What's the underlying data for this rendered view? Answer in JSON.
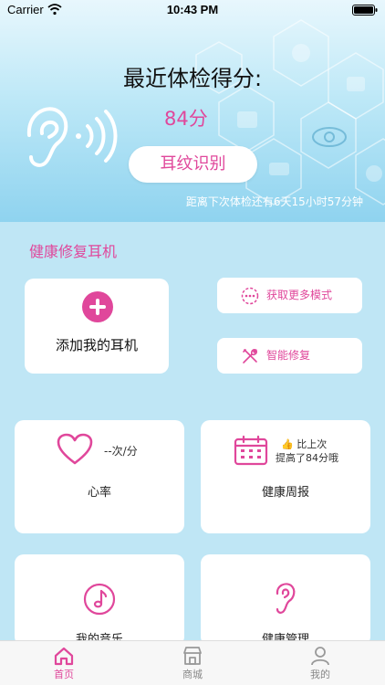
{
  "status_bar": {
    "carrier": "Carrier",
    "time": "10:43 PM"
  },
  "header": {
    "score_title": "最近体检得分:",
    "score_value": "84分",
    "earprint_button": "耳纹识别",
    "countdown": "距离下次体检还有6天15小时57分钟"
  },
  "section": {
    "title": "健康修复耳机"
  },
  "add_card": {
    "label": "添加我的耳机"
  },
  "pills": {
    "more_modes": "获取更多模式",
    "smart_repair": "智能修复"
  },
  "heart_card": {
    "rate": "--次/分",
    "label": "心率"
  },
  "report_card": {
    "compare_line1": "比上次",
    "compare_line2": "提高了84分哦",
    "label": "健康周报"
  },
  "music_card": {
    "label": "我的音乐"
  },
  "health_card": {
    "label": "健康管理"
  },
  "tabbar": {
    "home": "首页",
    "mall": "商城",
    "me": "我的"
  },
  "colors": {
    "accent": "#e0479b",
    "background": "#bfe6f5"
  }
}
